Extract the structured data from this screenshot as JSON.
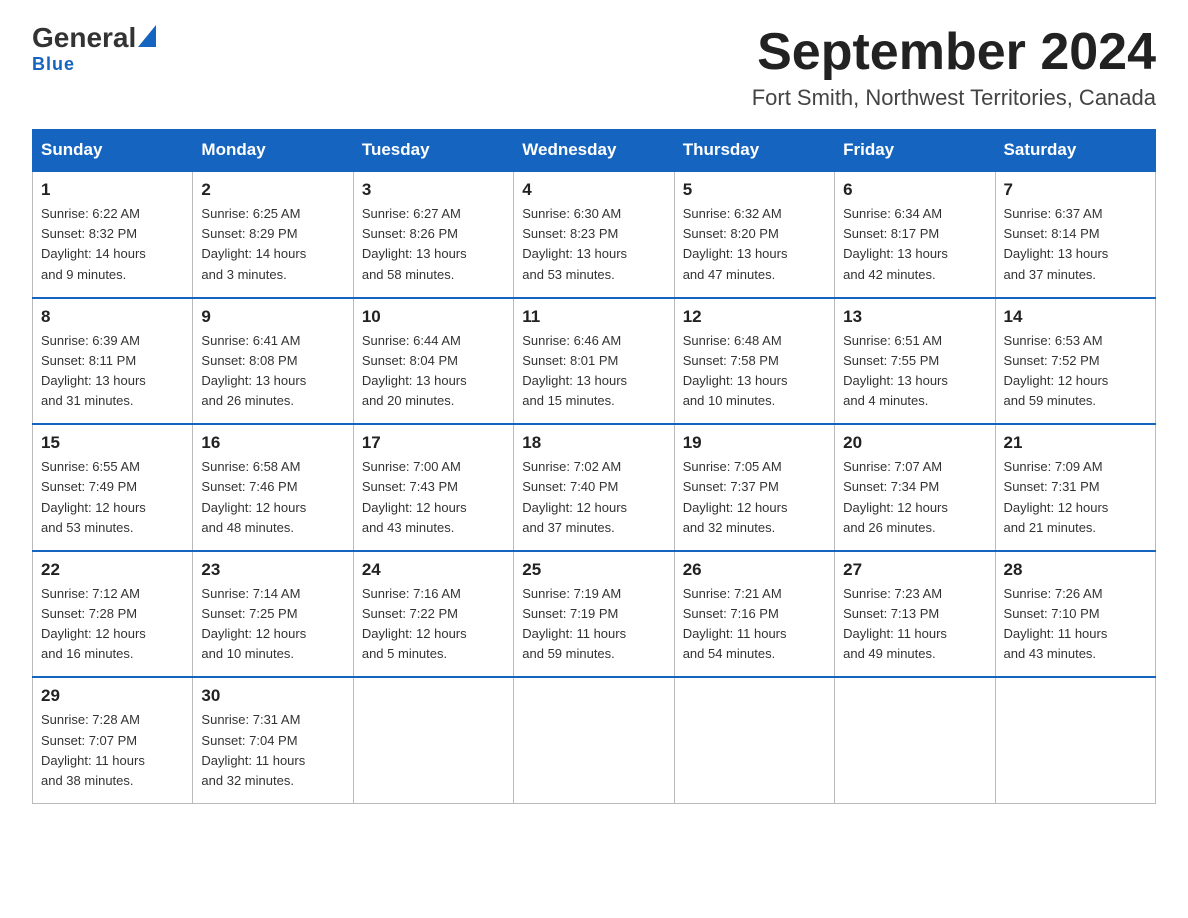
{
  "logo": {
    "general": "General",
    "triangle": "▶",
    "blue": "Blue"
  },
  "title": "September 2024",
  "location": "Fort Smith, Northwest Territories, Canada",
  "days_of_week": [
    "Sunday",
    "Monday",
    "Tuesday",
    "Wednesday",
    "Thursday",
    "Friday",
    "Saturday"
  ],
  "weeks": [
    [
      {
        "day": "1",
        "info": "Sunrise: 6:22 AM\nSunset: 8:32 PM\nDaylight: 14 hours\nand 9 minutes."
      },
      {
        "day": "2",
        "info": "Sunrise: 6:25 AM\nSunset: 8:29 PM\nDaylight: 14 hours\nand 3 minutes."
      },
      {
        "day": "3",
        "info": "Sunrise: 6:27 AM\nSunset: 8:26 PM\nDaylight: 13 hours\nand 58 minutes."
      },
      {
        "day": "4",
        "info": "Sunrise: 6:30 AM\nSunset: 8:23 PM\nDaylight: 13 hours\nand 53 minutes."
      },
      {
        "day": "5",
        "info": "Sunrise: 6:32 AM\nSunset: 8:20 PM\nDaylight: 13 hours\nand 47 minutes."
      },
      {
        "day": "6",
        "info": "Sunrise: 6:34 AM\nSunset: 8:17 PM\nDaylight: 13 hours\nand 42 minutes."
      },
      {
        "day": "7",
        "info": "Sunrise: 6:37 AM\nSunset: 8:14 PM\nDaylight: 13 hours\nand 37 minutes."
      }
    ],
    [
      {
        "day": "8",
        "info": "Sunrise: 6:39 AM\nSunset: 8:11 PM\nDaylight: 13 hours\nand 31 minutes."
      },
      {
        "day": "9",
        "info": "Sunrise: 6:41 AM\nSunset: 8:08 PM\nDaylight: 13 hours\nand 26 minutes."
      },
      {
        "day": "10",
        "info": "Sunrise: 6:44 AM\nSunset: 8:04 PM\nDaylight: 13 hours\nand 20 minutes."
      },
      {
        "day": "11",
        "info": "Sunrise: 6:46 AM\nSunset: 8:01 PM\nDaylight: 13 hours\nand 15 minutes."
      },
      {
        "day": "12",
        "info": "Sunrise: 6:48 AM\nSunset: 7:58 PM\nDaylight: 13 hours\nand 10 minutes."
      },
      {
        "day": "13",
        "info": "Sunrise: 6:51 AM\nSunset: 7:55 PM\nDaylight: 13 hours\nand 4 minutes."
      },
      {
        "day": "14",
        "info": "Sunrise: 6:53 AM\nSunset: 7:52 PM\nDaylight: 12 hours\nand 59 minutes."
      }
    ],
    [
      {
        "day": "15",
        "info": "Sunrise: 6:55 AM\nSunset: 7:49 PM\nDaylight: 12 hours\nand 53 minutes."
      },
      {
        "day": "16",
        "info": "Sunrise: 6:58 AM\nSunset: 7:46 PM\nDaylight: 12 hours\nand 48 minutes."
      },
      {
        "day": "17",
        "info": "Sunrise: 7:00 AM\nSunset: 7:43 PM\nDaylight: 12 hours\nand 43 minutes."
      },
      {
        "day": "18",
        "info": "Sunrise: 7:02 AM\nSunset: 7:40 PM\nDaylight: 12 hours\nand 37 minutes."
      },
      {
        "day": "19",
        "info": "Sunrise: 7:05 AM\nSunset: 7:37 PM\nDaylight: 12 hours\nand 32 minutes."
      },
      {
        "day": "20",
        "info": "Sunrise: 7:07 AM\nSunset: 7:34 PM\nDaylight: 12 hours\nand 26 minutes."
      },
      {
        "day": "21",
        "info": "Sunrise: 7:09 AM\nSunset: 7:31 PM\nDaylight: 12 hours\nand 21 minutes."
      }
    ],
    [
      {
        "day": "22",
        "info": "Sunrise: 7:12 AM\nSunset: 7:28 PM\nDaylight: 12 hours\nand 16 minutes."
      },
      {
        "day": "23",
        "info": "Sunrise: 7:14 AM\nSunset: 7:25 PM\nDaylight: 12 hours\nand 10 minutes."
      },
      {
        "day": "24",
        "info": "Sunrise: 7:16 AM\nSunset: 7:22 PM\nDaylight: 12 hours\nand 5 minutes."
      },
      {
        "day": "25",
        "info": "Sunrise: 7:19 AM\nSunset: 7:19 PM\nDaylight: 11 hours\nand 59 minutes."
      },
      {
        "day": "26",
        "info": "Sunrise: 7:21 AM\nSunset: 7:16 PM\nDaylight: 11 hours\nand 54 minutes."
      },
      {
        "day": "27",
        "info": "Sunrise: 7:23 AM\nSunset: 7:13 PM\nDaylight: 11 hours\nand 49 minutes."
      },
      {
        "day": "28",
        "info": "Sunrise: 7:26 AM\nSunset: 7:10 PM\nDaylight: 11 hours\nand 43 minutes."
      }
    ],
    [
      {
        "day": "29",
        "info": "Sunrise: 7:28 AM\nSunset: 7:07 PM\nDaylight: 11 hours\nand 38 minutes."
      },
      {
        "day": "30",
        "info": "Sunrise: 7:31 AM\nSunset: 7:04 PM\nDaylight: 11 hours\nand 32 minutes."
      },
      {
        "day": "",
        "info": ""
      },
      {
        "day": "",
        "info": ""
      },
      {
        "day": "",
        "info": ""
      },
      {
        "day": "",
        "info": ""
      },
      {
        "day": "",
        "info": ""
      }
    ]
  ]
}
